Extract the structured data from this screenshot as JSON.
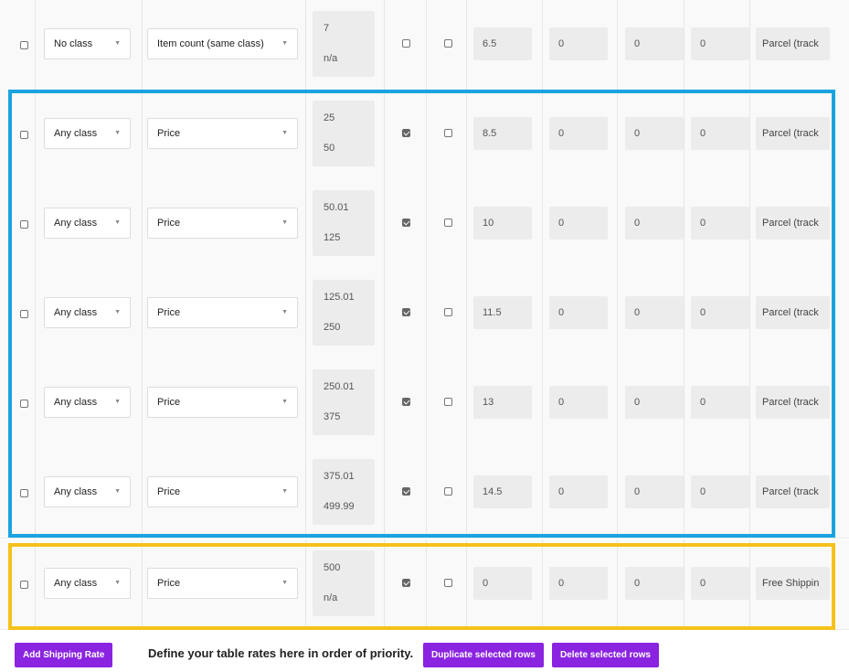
{
  "rows": [
    {
      "cls": "No class",
      "cond": "Item count (same class)",
      "min": "7",
      "max": "n/a",
      "cb1": false,
      "cb2": false,
      "cost1": "6.5",
      "cost2": "0",
      "cost3": "0",
      "cost4": "0",
      "label": "Parcel (track"
    },
    {
      "cls": "Any class",
      "cond": "Price",
      "min": "25",
      "max": "50",
      "cb1": true,
      "cb2": false,
      "cost1": "8.5",
      "cost2": "0",
      "cost3": "0",
      "cost4": "0",
      "label": "Parcel (track"
    },
    {
      "cls": "Any class",
      "cond": "Price",
      "min": "50.01",
      "max": "125",
      "cb1": true,
      "cb2": false,
      "cost1": "10",
      "cost2": "0",
      "cost3": "0",
      "cost4": "0",
      "label": "Parcel (track"
    },
    {
      "cls": "Any class",
      "cond": "Price",
      "min": "125.01",
      "max": "250",
      "cb1": true,
      "cb2": false,
      "cost1": "11.5",
      "cost2": "0",
      "cost3": "0",
      "cost4": "0",
      "label": "Parcel (track"
    },
    {
      "cls": "Any class",
      "cond": "Price",
      "min": "250.01",
      "max": "375",
      "cb1": true,
      "cb2": false,
      "cost1": "13",
      "cost2": "0",
      "cost3": "0",
      "cost4": "0",
      "label": "Parcel (track"
    },
    {
      "cls": "Any class",
      "cond": "Price",
      "min": "375.01",
      "max": "499.99",
      "cb1": true,
      "cb2": false,
      "cost1": "14.5",
      "cost2": "0",
      "cost3": "0",
      "cost4": "0",
      "label": "Parcel (track"
    },
    {
      "cls": "Any class",
      "cond": "Price",
      "min": "500",
      "max": "n/a",
      "cb1": true,
      "cb2": false,
      "cost1": "0",
      "cost2": "0",
      "cost3": "0",
      "cost4": "0",
      "label": "Free Shippin"
    }
  ],
  "footer": {
    "add_label": "Add Shipping Rate",
    "hint": "Define your table rates here in order of priority.",
    "duplicate_label": "Duplicate selected rows",
    "delete_label": "Delete selected rows"
  },
  "colors": {
    "accent": "#8a24e0",
    "highlight_blue": "#1aa3e0",
    "highlight_yellow": "#f5c21b"
  },
  "icons": {
    "dropdown": "chevron-down-icon"
  }
}
